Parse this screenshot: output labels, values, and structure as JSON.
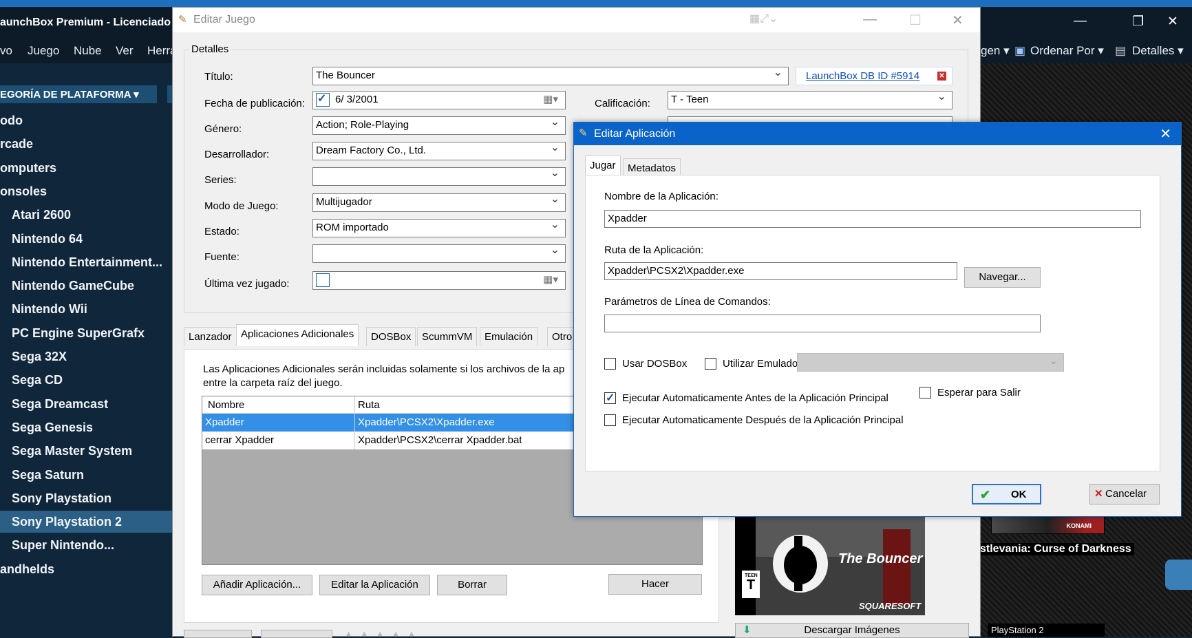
{
  "launchbox": {
    "title": "aunchBox Premium - Licenciado",
    "menu": [
      "vo",
      "Juego",
      "Nube",
      "Ver",
      "Herra",
      "gen ▾",
      "Ordenar Por ▾",
      "Detalles ▾"
    ],
    "category_button": "EGORÍA DE PLATAFORMA ▾",
    "sidebar": [
      {
        "label": "odo",
        "indent": 0
      },
      {
        "label": "rcade",
        "indent": 0
      },
      {
        "label": "omputers",
        "indent": 0
      },
      {
        "label": "onsoles",
        "indent": 0
      },
      {
        "label": "Atari 2600",
        "indent": 1
      },
      {
        "label": "Nintendo 64",
        "indent": 1
      },
      {
        "label": "Nintendo Entertainment...",
        "indent": 1
      },
      {
        "label": "Nintendo GameCube",
        "indent": 1
      },
      {
        "label": "Nintendo Wii",
        "indent": 1
      },
      {
        "label": "PC Engine SuperGrafx",
        "indent": 1
      },
      {
        "label": "Sega 32X",
        "indent": 1
      },
      {
        "label": "Sega CD",
        "indent": 1
      },
      {
        "label": "Sega Dreamcast",
        "indent": 1
      },
      {
        "label": "Sega Genesis",
        "indent": 1
      },
      {
        "label": "Sega Master System",
        "indent": 1
      },
      {
        "label": "Sega Saturn",
        "indent": 1
      },
      {
        "label": "Sony Playstation",
        "indent": 1
      },
      {
        "label": "Sony Playstation 2",
        "indent": 1,
        "selected": true
      },
      {
        "label": "Super Nintendo...",
        "indent": 1
      },
      {
        "label": "andhelds",
        "indent": 0
      }
    ],
    "right_game_label": "stlevania: Curse of Darkness",
    "thumb_brand": "KONAMI",
    "ps2_label": "PlayStation 2"
  },
  "editar_juego": {
    "title": "Editar Juego",
    "group_label": "Detalles",
    "fields": {
      "titulo_label": "Título:",
      "titulo_value": "The Bouncer",
      "db_link": "LaunchBox DB ID #5914",
      "fecha_label": "Fecha de publicación:",
      "fecha_value": "6/  3/2001",
      "calificacion_label": "Calificación:",
      "calificacion_value": "T - Teen",
      "genero_label": "Género:",
      "genero_value": "Action; Role-Playing",
      "desarrollador_label": "Desarrollador:",
      "desarrollador_value": "Dream Factory Co., Ltd.",
      "series_label": "Series:",
      "series_value": "",
      "modo_label": "Modo de Juego:",
      "modo_value": "Multijugador",
      "estado_label": "Estado:",
      "estado_value": "ROM importado",
      "fuente_label": "Fuente:",
      "fuente_value": "",
      "ultima_label": "Última vez jugado:",
      "ultima_value": ""
    },
    "tabs": [
      "Lanzador",
      "Aplicaciones Adicionales",
      "DOSBox",
      "ScummVM",
      "Emulación",
      "Otro"
    ],
    "info_line1": "Las Aplicaciones Adicionales serán incluidas solamente si los archivos de la ap",
    "info_line2": "entre la carpeta raíz del juego.",
    "grid": {
      "headers": [
        "Nombre",
        "Ruta"
      ],
      "rows": [
        {
          "nombre": "Xpadder",
          "ruta": "Xpadder\\PCSX2\\Xpadder.exe",
          "selected": true
        },
        {
          "nombre": "cerrar Xpadder",
          "ruta": "Xpadder\\PCSX2\\cerrar Xpadder.bat",
          "selected": false
        }
      ]
    },
    "buttons": {
      "add": "Añadir Aplicación...",
      "edit": "Editar la Aplicación",
      "delete": "Borrar",
      "do": "Hacer",
      "download_images": "Descargar Imágenes"
    },
    "cover": {
      "logo": "The Bouncer",
      "brand": "SQUARESOFT",
      "rating": "TEEN"
    }
  },
  "editar_aplicacion": {
    "title": "Editar Aplicación",
    "tabs": [
      "Jugar",
      "Metadatos"
    ],
    "nombre_label": "Nombre de la Aplicación:",
    "nombre_value": "Xpadder",
    "ruta_label": "Ruta de la Aplicación:",
    "ruta_value": "Xpadder\\PCSX2\\Xpadder.exe",
    "navegar": "Navegar...",
    "parametros_label": "Parámetros de Línea de Comandos:",
    "parametros_value": "",
    "usar_dosbox": "Usar DOSBox",
    "utilizar_emulador": "Utilizar Emulado",
    "esperar": "Esperar para Salir",
    "antes": "Ejecutar Automaticamente Antes de la Aplicación Principal",
    "despues": "Ejecutar Automaticamente Después de la Aplicación Principal",
    "ok": "OK",
    "cancelar": "Cancelar",
    "checks": {
      "usar_dosbox": false,
      "utilizar_emulador": false,
      "esperar": false,
      "antes": true,
      "despues": false
    }
  }
}
